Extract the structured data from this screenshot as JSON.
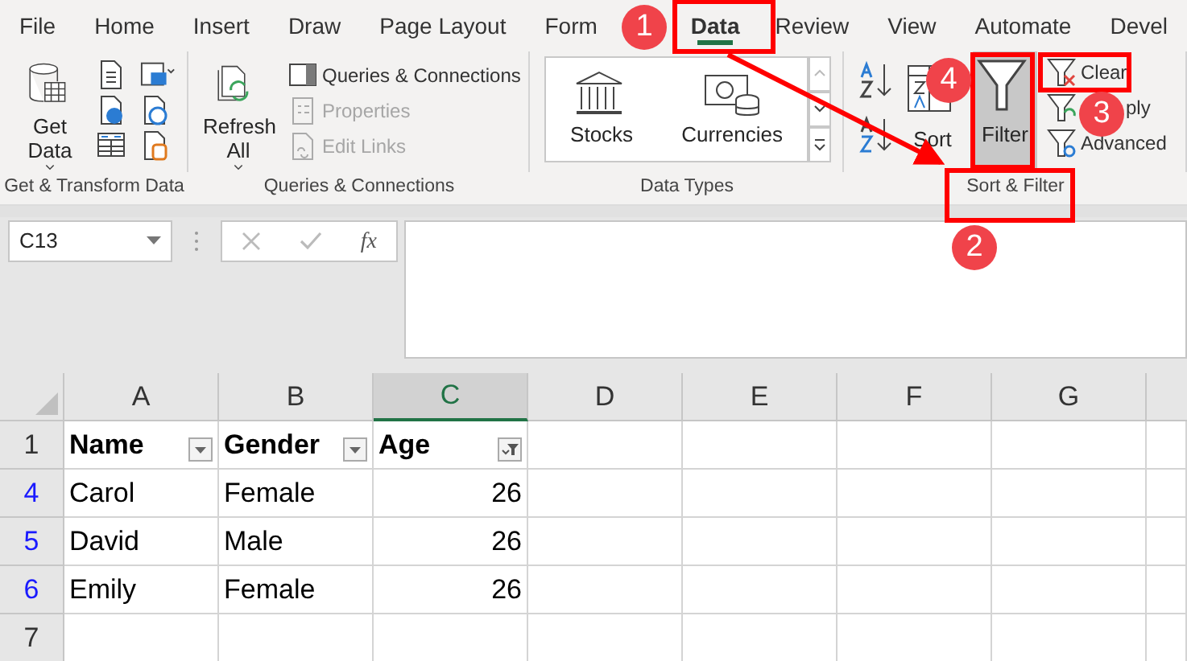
{
  "menu_tabs": [
    {
      "label": "File",
      "selected": false
    },
    {
      "label": "Home",
      "selected": false
    },
    {
      "label": "Insert",
      "selected": false
    },
    {
      "label": "Draw",
      "selected": false
    },
    {
      "label": "Page Layout",
      "selected": false
    },
    {
      "label": "Form",
      "selected": false
    },
    {
      "label": "Data",
      "selected": true
    },
    {
      "label": "Review",
      "selected": false
    },
    {
      "label": "View",
      "selected": false
    },
    {
      "label": "Automate",
      "selected": false
    },
    {
      "label": "Devel",
      "selected": false
    }
  ],
  "ribbon_groups": [
    {
      "label": "Get & Transform Data",
      "buttons": [
        {
          "kind": "large",
          "label": "Get Data",
          "dropdown": true,
          "pressed": false
        }
      ]
    },
    {
      "label": "Queries & Connections",
      "buttons": [
        {
          "kind": "large",
          "label": "Refresh All",
          "dropdown": true,
          "pressed": false
        },
        {
          "kind": "small",
          "label": "Queries & Connections",
          "disabled": false
        },
        {
          "kind": "small",
          "label": "Properties",
          "disabled": true
        },
        {
          "kind": "small",
          "label": "Edit Links",
          "disabled": true
        }
      ]
    },
    {
      "label": "Data Types",
      "buttons": [
        {
          "kind": "gallery",
          "label": "Stocks"
        },
        {
          "kind": "gallery",
          "label": "Currencies"
        }
      ]
    },
    {
      "label": "Sort & Filter",
      "buttons": [
        {
          "kind": "large",
          "label": "Sort",
          "dropdown": false,
          "pressed": false
        },
        {
          "kind": "large",
          "label": "Filter",
          "dropdown": false,
          "pressed": true
        },
        {
          "kind": "small",
          "label": "Clear",
          "disabled": false
        },
        {
          "kind": "small",
          "label": "ply",
          "disabled": false
        },
        {
          "kind": "small",
          "label": "Advanced",
          "disabled": false
        }
      ]
    }
  ],
  "formula_bar": {
    "name_box": "C13",
    "function_button": "fx"
  },
  "sheet": {
    "columns": [
      {
        "label": "A",
        "selected": false
      },
      {
        "label": "B",
        "selected": false
      },
      {
        "label": "C",
        "selected": true
      },
      {
        "label": "D",
        "selected": false
      },
      {
        "label": "E",
        "selected": false
      },
      {
        "label": "F",
        "selected": false
      },
      {
        "label": "G",
        "selected": false
      }
    ],
    "rows": [
      {
        "number": "1",
        "filtered": false,
        "cells": [
          {
            "kind": "header",
            "text": "Name",
            "filter_applied": false
          },
          {
            "kind": "header",
            "text": "Gender",
            "filter_applied": false
          },
          {
            "kind": "header",
            "text": "Age",
            "filter_applied": true
          }
        ]
      },
      {
        "number": "4",
        "filtered": true,
        "cells": [
          {
            "kind": "text",
            "text": "Carol"
          },
          {
            "kind": "text",
            "text": "Female"
          },
          {
            "kind": "number",
            "text": "26"
          }
        ]
      },
      {
        "number": "5",
        "filtered": true,
        "cells": [
          {
            "kind": "text",
            "text": "David"
          },
          {
            "kind": "text",
            "text": "Male"
          },
          {
            "kind": "number",
            "text": "26"
          }
        ]
      },
      {
        "number": "6",
        "filtered": true,
        "cells": [
          {
            "kind": "text",
            "text": "Emily"
          },
          {
            "kind": "text",
            "text": "Female"
          },
          {
            "kind": "number",
            "text": "26"
          }
        ]
      },
      {
        "number": "7",
        "filtered": false,
        "cells": []
      }
    ]
  },
  "callouts": [
    {
      "number": "1"
    },
    {
      "number": "2"
    },
    {
      "number": "3"
    },
    {
      "number": "4"
    }
  ]
}
